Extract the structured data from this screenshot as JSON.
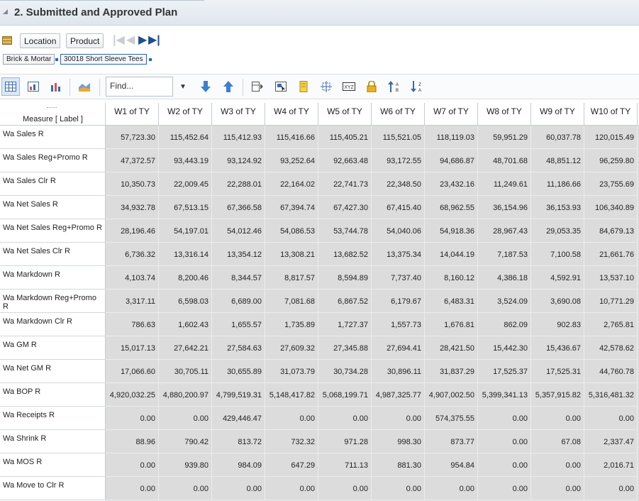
{
  "section_title": "2. Submitted and Approved Plan",
  "pov": {
    "location_label": "Location",
    "product_label": "Product",
    "nav_first": "|◀",
    "nav_prev": "◀",
    "nav_next": "▶",
    "nav_last": "▶|",
    "chips": [
      "Brick & Mortar",
      "30018 Short Sleeve Tees"
    ]
  },
  "toolbar": {
    "find_placeholder": "Find...",
    "icons": [
      "table-view-icon",
      "chart-table-icon",
      "bar-chart-icon",
      "area-chart-icon",
      "find-dropdown-icon",
      "arrow-down-icon",
      "arrow-up-icon",
      "pivot-icon",
      "select-icon",
      "highlight-icon",
      "split-icon",
      "xyz-icon",
      "lock-icon",
      "sort-asc-icon",
      "sort-desc-icon"
    ]
  },
  "grid": {
    "measure_header": "Measure [ Label ]",
    "columns": [
      "W1 of TY",
      "W2 of TY",
      "W3 of TY",
      "W4 of TY",
      "W5 of TY",
      "W6 of TY",
      "W7 of TY",
      "W8 of TY",
      "W9 of TY",
      "W10 of TY"
    ],
    "rows": [
      {
        "label": "Wa Sales R",
        "values": [
          "57,723.30",
          "115,452.64",
          "115,412.93",
          "115,416.66",
          "115,405.21",
          "115,521.05",
          "118,119.03",
          "59,951.29",
          "60,037.78",
          "120,015.49"
        ]
      },
      {
        "label": "Wa Sales Reg+Promo R",
        "values": [
          "47,372.57",
          "93,443.19",
          "93,124.92",
          "93,252.64",
          "92,663.48",
          "93,172.55",
          "94,686.87",
          "48,701.68",
          "48,851.12",
          "96,259.80"
        ]
      },
      {
        "label": "Wa Sales Clr R",
        "values": [
          "10,350.73",
          "22,009.45",
          "22,288.01",
          "22,164.02",
          "22,741.73",
          "22,348.50",
          "23,432.16",
          "11,249.61",
          "11,186.66",
          "23,755.69"
        ]
      },
      {
        "label": "Wa Net Sales R",
        "values": [
          "34,932.78",
          "67,513.15",
          "67,366.58",
          "67,394.74",
          "67,427.30",
          "67,415.40",
          "68,962.55",
          "36,154.96",
          "36,153.93",
          "106,340.89"
        ]
      },
      {
        "label": "Wa Net Sales Reg+Promo R",
        "values": [
          "28,196.46",
          "54,197.01",
          "54,012.46",
          "54,086.53",
          "53,744.78",
          "54,040.06",
          "54,918.36",
          "28,967.43",
          "29,053.35",
          "84,679.13"
        ]
      },
      {
        "label": "Wa Net Sales Clr R",
        "values": [
          "6,736.32",
          "13,316.14",
          "13,354.12",
          "13,308.21",
          "13,682.52",
          "13,375.34",
          "14,044.19",
          "7,187.53",
          "7,100.58",
          "21,661.76"
        ]
      },
      {
        "label": "Wa Markdown R",
        "values": [
          "4,103.74",
          "8,200.46",
          "8,344.57",
          "8,817.57",
          "8,594.89",
          "7,737.40",
          "8,160.12",
          "4,386.18",
          "4,592.91",
          "13,537.10"
        ]
      },
      {
        "label": "Wa Markdown Reg+Promo R",
        "values": [
          "3,317.11",
          "6,598.03",
          "6,689.00",
          "7,081.68",
          "6,867.52",
          "6,179.67",
          "6,483.31",
          "3,524.09",
          "3,690.08",
          "10,771.29"
        ]
      },
      {
        "label": "Wa Markdown Clr R",
        "values": [
          "786.63",
          "1,602.43",
          "1,655.57",
          "1,735.89",
          "1,727.37",
          "1,557.73",
          "1,676.81",
          "862.09",
          "902.83",
          "2,765.81"
        ]
      },
      {
        "label": "Wa GM R",
        "values": [
          "15,017.13",
          "27,642.21",
          "27,584.63",
          "27,609.32",
          "27,345.88",
          "27,694.41",
          "28,421.50",
          "15,442.30",
          "15,436.67",
          "42,578.62"
        ]
      },
      {
        "label": "Wa Net GM R",
        "values": [
          "17,066.60",
          "30,705.11",
          "30,655.89",
          "31,073.79",
          "30,734.28",
          "30,896.11",
          "31,837.29",
          "17,525.37",
          "17,525.31",
          "44,760.78"
        ]
      },
      {
        "label": "Wa BOP R",
        "values": [
          "4,920,032.25",
          "4,880,200.97",
          "4,799,519.31",
          "5,148,417.82",
          "5,068,199.71",
          "4,987,325.77",
          "4,907,002.50",
          "5,399,341.13",
          "5,357,915.82",
          "5,316,481.32"
        ]
      },
      {
        "label": "Wa Receipts R",
        "values": [
          "0.00",
          "0.00",
          "429,446.47",
          "0.00",
          "0.00",
          "0.00",
          "574,375.55",
          "0.00",
          "0.00",
          "0.00"
        ]
      },
      {
        "label": "Wa Shrink R",
        "values": [
          "88.96",
          "790.42",
          "813.72",
          "732.32",
          "971.28",
          "998.30",
          "873.77",
          "0.00",
          "67.08",
          "2,337.47"
        ]
      },
      {
        "label": "Wa MOS R",
        "values": [
          "0.00",
          "939.80",
          "984.09",
          "647.29",
          "711.13",
          "881.30",
          "954.84",
          "0.00",
          "0.00",
          "2,016.71"
        ]
      },
      {
        "label": "Wa Move to Clr R",
        "values": [
          "0.00",
          "0.00",
          "0.00",
          "0.00",
          "0.00",
          "0.00",
          "0.00",
          "0.00",
          "0.00",
          "0.00"
        ]
      }
    ]
  }
}
